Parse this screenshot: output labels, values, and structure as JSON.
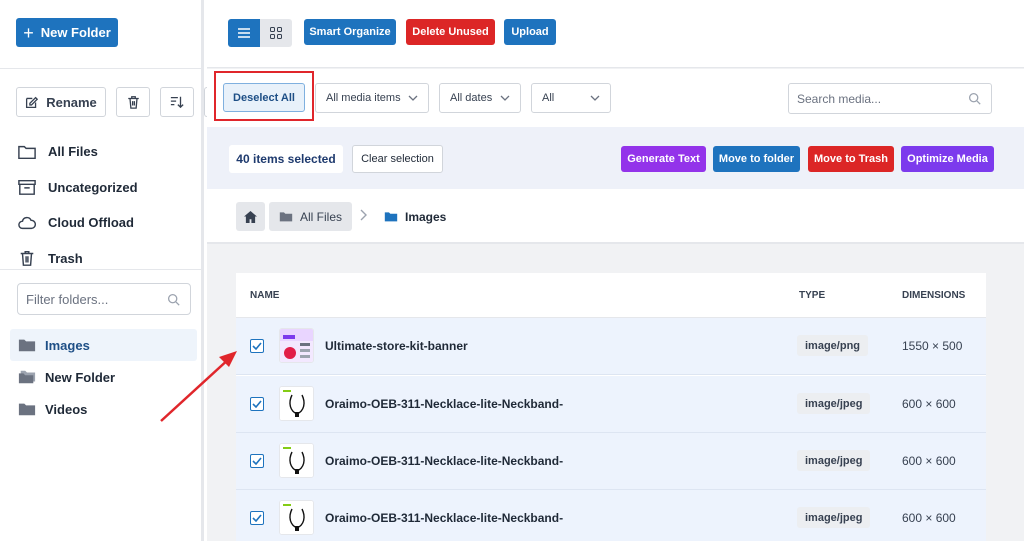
{
  "sidebar": {
    "new_folder_label": "New Folder",
    "rename_label": "Rename",
    "folders": [
      {
        "label": "All Files",
        "icon": "folder-outline-icon"
      },
      {
        "label": "Uncategorized",
        "icon": "archive-icon"
      },
      {
        "label": "Cloud Offload",
        "icon": "cloud-icon"
      },
      {
        "label": "Trash",
        "icon": "trash-icon"
      }
    ],
    "filter_placeholder": "Filter folders...",
    "tree": [
      {
        "label": "Images",
        "active": true
      },
      {
        "label": "New Folder",
        "active": false
      },
      {
        "label": "Videos",
        "active": false
      }
    ]
  },
  "toolbar": {
    "smart_organize": "Smart Organize",
    "delete_unused": "Delete Unused",
    "upload": "Upload"
  },
  "filters": {
    "deselect_all": "Deselect All",
    "media_type": "All media items",
    "dates": "All dates",
    "all": "All",
    "search_placeholder": "Search media..."
  },
  "selection": {
    "count_text": "40 items selected",
    "clear_label": "Clear selection",
    "generate_text": "Generate Text",
    "move_to_folder": "Move to folder",
    "move_to_trash": "Move to Trash",
    "optimize_media": "Optimize Media"
  },
  "breadcrumb": {
    "all_files": "All Files",
    "current": "Images"
  },
  "table": {
    "headers": {
      "name": "NAME",
      "type": "TYPE",
      "dimensions": "DIMENSIONS"
    },
    "rows": [
      {
        "name": "Ultimate-store-kit-banner",
        "type": "image/png",
        "dimensions": "1550 × 500",
        "checked": true
      },
      {
        "name": "Oraimo-OEB-311-Necklace-lite-Neckband-",
        "type": "image/jpeg",
        "dimensions": "600 × 600",
        "checked": true
      },
      {
        "name": "Oraimo-OEB-311-Necklace-lite-Neckband-",
        "type": "image/jpeg",
        "dimensions": "600 × 600",
        "checked": true
      },
      {
        "name": "Oraimo-OEB-311-Necklace-lite-Neckband-",
        "type": "image/jpeg",
        "dimensions": "600 × 600",
        "checked": true
      }
    ]
  },
  "colors": {
    "primary": "#1e73be",
    "danger": "#dc2626",
    "purple": "#9333ea",
    "violet": "#7c3aed",
    "annotation": "#e0262b"
  }
}
